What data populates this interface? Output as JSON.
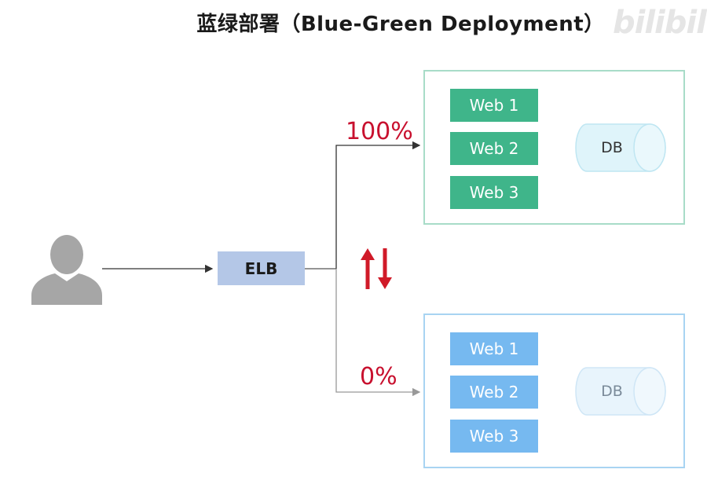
{
  "title": "蓝绿部署（Blue-Green Deployment）",
  "watermark": "bilibili",
  "user": {
    "icon": "user-silhouette-icon"
  },
  "elb": {
    "label": "ELB"
  },
  "routing": {
    "green_percent": "100%",
    "blue_percent": "0%",
    "swap_icon": "swap-arrows-icon"
  },
  "green_env": {
    "web_servers": [
      "Web 1",
      "Web 2",
      "Web 3"
    ],
    "db_label": "DB"
  },
  "blue_env": {
    "web_servers": [
      "Web 1",
      "Web 2",
      "Web 3"
    ],
    "db_label": "DB"
  },
  "colors": {
    "green_web": "#3fb58a",
    "blue_web": "#76b9f0",
    "green_border": "#a8dcc8",
    "blue_border": "#a8d4f2",
    "elb_fill": "#b4c7e7",
    "percent_text": "#c8102e",
    "arrow_red": "#d01a28"
  }
}
